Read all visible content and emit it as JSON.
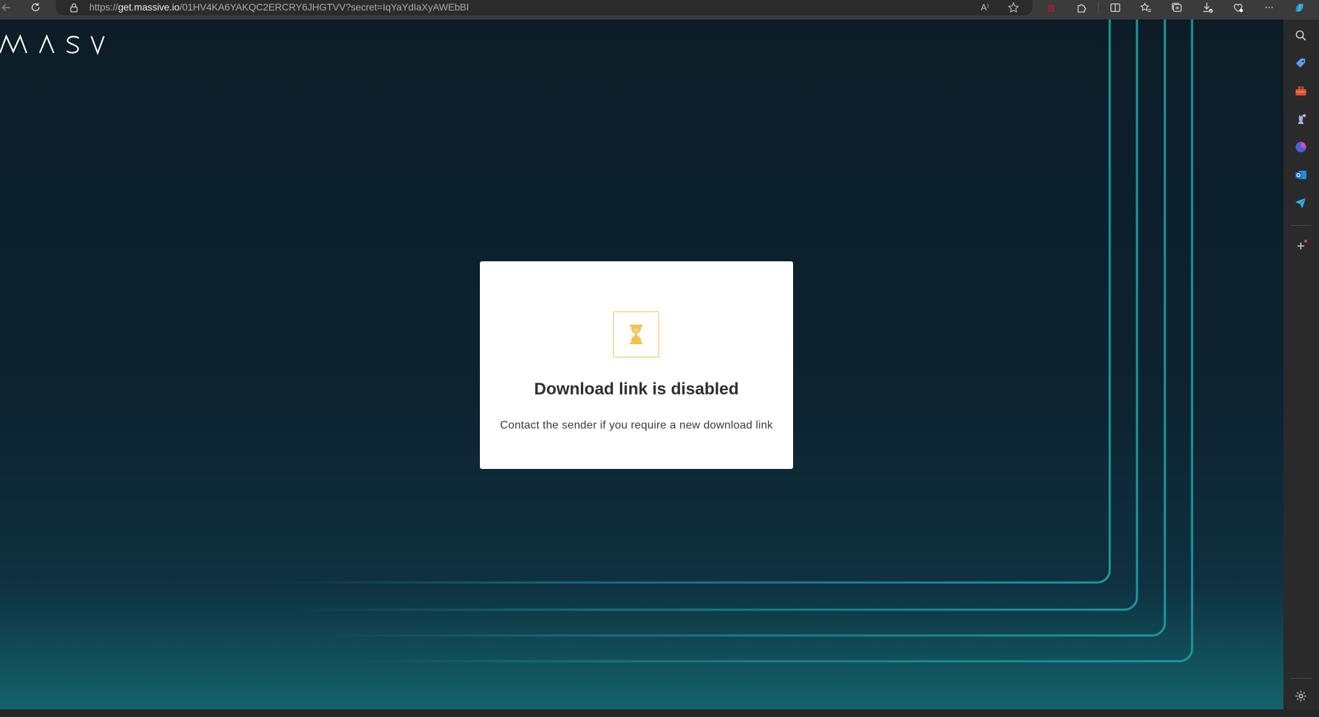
{
  "browser": {
    "url_prefix": "https://",
    "url_domain": "get.massive.io",
    "url_path": "/01HV4KA6YAKQC2ERCRY6JHGTVV?secret=IqYaYdIaXyAWEbBI",
    "read_aloud_label": "A⁾",
    "more_label": "···"
  },
  "page": {
    "logo_text": "MASV",
    "dialog": {
      "title": "Download link is disabled",
      "message": "Contact the sender if you require a new download link",
      "icon": "hourglass-icon"
    }
  },
  "colors": {
    "accent_yellow": "#f2c14e",
    "background_top": "#0c1d27",
    "background_bottom": "#13636a",
    "line_teal": "#1a9aa0"
  }
}
